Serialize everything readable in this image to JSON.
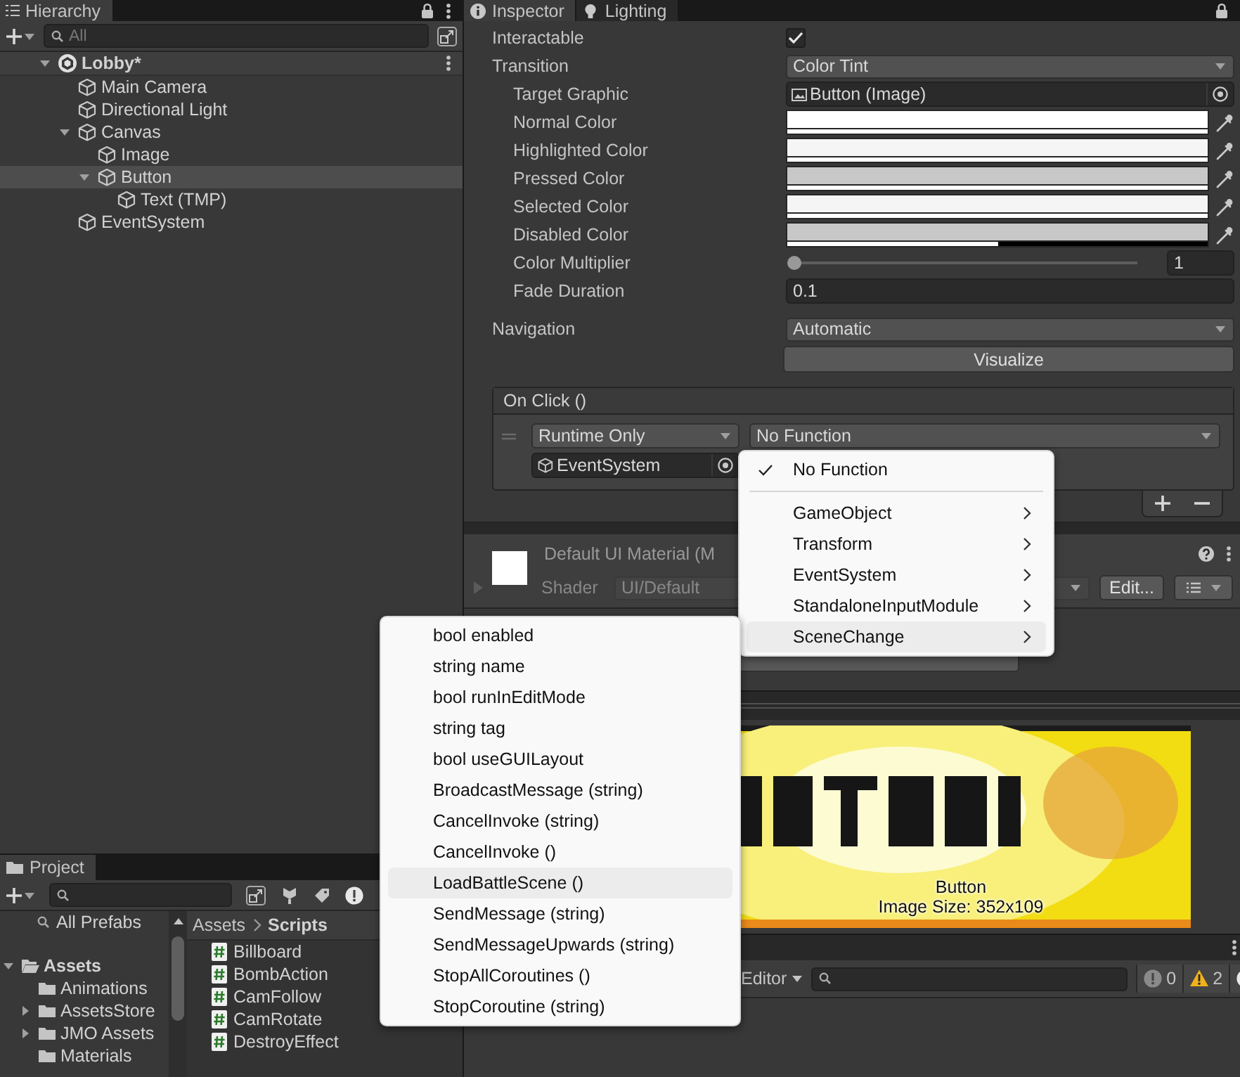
{
  "hierarchy": {
    "title": "Hierarchy",
    "search_placeholder": "All",
    "scene": {
      "name": "Lobby*",
      "expanded": true,
      "children": [
        {
          "name": "Main Camera",
          "selected": false
        },
        {
          "name": "Directional Light",
          "selected": false
        },
        {
          "name": "Canvas",
          "selected": false,
          "expanded": true,
          "children": [
            {
              "name": "Image",
              "selected": false
            },
            {
              "name": "Button",
              "selected": true,
              "expanded": true,
              "children": [
                {
                  "name": "Text (TMP)",
                  "selected": false
                }
              ]
            }
          ]
        },
        {
          "name": "EventSystem",
          "selected": false
        }
      ]
    }
  },
  "project": {
    "title": "Project",
    "favorites": [
      "All Prefabs"
    ],
    "folders": {
      "name": "Assets",
      "expanded": true,
      "children": [
        {
          "name": "Animations"
        },
        {
          "name": "AssetsStore",
          "expanded": false
        },
        {
          "name": "JMO Assets",
          "expanded": false
        },
        {
          "name": "Materials"
        }
      ]
    },
    "breadcrumb": [
      "Assets",
      "Scripts"
    ],
    "files": [
      "Billboard",
      "BombAction",
      "CamFollow",
      "CamRotate",
      "DestroyEffect"
    ]
  },
  "inspector": {
    "tabs": [
      {
        "label": "Inspector",
        "kind": "info",
        "selected": true
      },
      {
        "label": "Lighting",
        "kind": "light",
        "selected": false
      }
    ],
    "properties": [
      {
        "kind": "checkbox",
        "label": "Interactable",
        "indented": false,
        "checked": true
      },
      {
        "kind": "dropdown",
        "label": "Transition",
        "indented": false,
        "value": "Color Tint"
      },
      {
        "kind": "object",
        "label": "Target Graphic",
        "indented": true,
        "value": "Button (Image)"
      },
      {
        "kind": "color",
        "label": "Normal Color",
        "indented": true,
        "color": "#ffffff",
        "level": 1
      },
      {
        "kind": "color",
        "label": "Highlighted Color",
        "indented": true,
        "color": "#f5f5f5",
        "level": 1
      },
      {
        "kind": "color",
        "label": "Pressed Color",
        "indented": true,
        "color": "#c8c8c8",
        "level": 1
      },
      {
        "kind": "color",
        "label": "Selected Color",
        "indented": true,
        "color": "#f5f5f5",
        "level": 1
      },
      {
        "kind": "color",
        "label": "Disabled Color",
        "indented": true,
        "color": "#c8c8c8",
        "level": 0.5
      },
      {
        "kind": "slider",
        "label": "Color Multiplier",
        "indented": true,
        "level": 0,
        "value": "1"
      },
      {
        "kind": "number",
        "label": "Fade Duration",
        "indented": true,
        "value": "0.1"
      }
    ],
    "navigation": {
      "label": "Navigation",
      "value": "Automatic",
      "button": "Visualize"
    },
    "on_click": {
      "title": "On Click ()",
      "entries": [
        {
          "mode": "Runtime Only",
          "function": "No Function",
          "target": "EventSystem"
        }
      ]
    },
    "material": {
      "name": "Default UI Material (M",
      "shader_label": "Shader",
      "shader": "UI/Default",
      "edit_button": "Edit..."
    }
  },
  "preview": {
    "caption": "Button",
    "image_size": "Image Size: 352x109"
  },
  "console": {
    "mode": "Editor",
    "counters": [
      {
        "kind": "info",
        "count": "0"
      },
      {
        "kind": "warning",
        "count": "2"
      },
      {
        "kind": "error"
      }
    ]
  },
  "function_menu": {
    "items": [
      {
        "label": "No Function",
        "checked": true,
        "submenu": false,
        "selected": false
      },
      {
        "label": "GameObject",
        "checked": false,
        "submenu": true,
        "selected": false
      },
      {
        "label": "Transform",
        "checked": false,
        "submenu": true,
        "selected": false
      },
      {
        "label": "EventSystem",
        "checked": false,
        "submenu": true,
        "selected": false
      },
      {
        "label": "StandaloneInputModule",
        "checked": false,
        "submenu": true,
        "selected": false
      },
      {
        "label": "SceneChange",
        "checked": false,
        "submenu": true,
        "selected": true
      }
    ]
  },
  "method_menu": {
    "items": [
      {
        "label": "bool enabled",
        "selected": false
      },
      {
        "label": "string name",
        "selected": false
      },
      {
        "label": "bool runInEditMode",
        "selected": false
      },
      {
        "label": "string tag",
        "selected": false
      },
      {
        "label": "bool useGUILayout",
        "selected": false
      },
      {
        "label": "BroadcastMessage (string)",
        "selected": false
      },
      {
        "label": "CancelInvoke (string)",
        "selected": false
      },
      {
        "label": "CancelInvoke ()",
        "selected": false
      },
      {
        "label": "LoadBattleScene ()",
        "selected": true
      },
      {
        "label": "SendMessage (string)",
        "selected": false
      },
      {
        "label": "SendMessageUpwards (string)",
        "selected": false
      },
      {
        "label": "StopAllCoroutines ()",
        "selected": false
      },
      {
        "label": "StopCoroutine (string)",
        "selected": false
      }
    ]
  }
}
